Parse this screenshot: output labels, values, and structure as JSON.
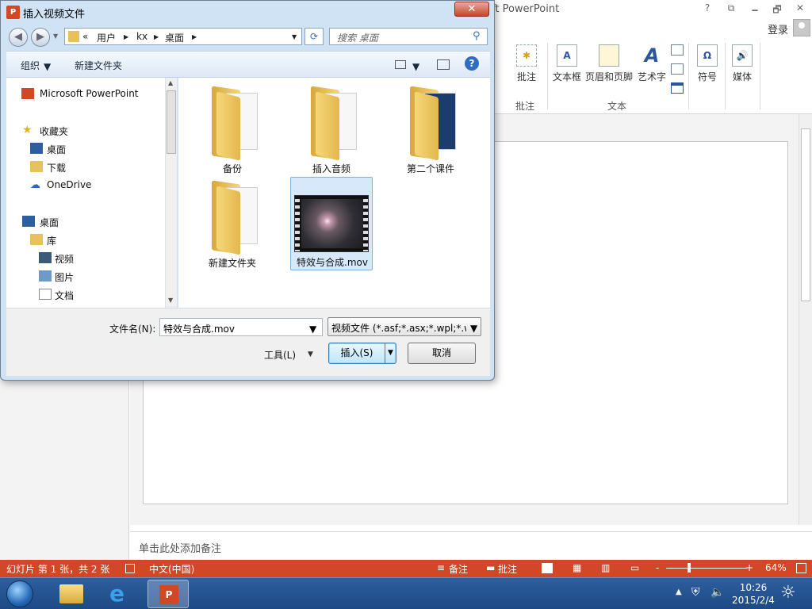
{
  "powerpoint": {
    "title_fragment": "ft PowerPoint",
    "window_controls": {
      "help": "?",
      "restore_ribbon": "⧉",
      "minimize": "🗕",
      "maximize": "🗗",
      "close": "✕"
    },
    "login": "登录",
    "ribbon": {
      "buttons": [
        {
          "label": "批注",
          "icon": "comment-icon"
        },
        {
          "label": "文本框",
          "icon": "textbox-icon"
        },
        {
          "label": "页眉和页脚",
          "icon": "header-footer-icon"
        },
        {
          "label": "艺术字",
          "icon": "wordart-icon"
        },
        {
          "label": "符号",
          "icon": "symbol-icon"
        },
        {
          "label": "媒体",
          "icon": "media-icon"
        }
      ],
      "groups": [
        "批注",
        "文本"
      ],
      "symbol_glyph": "Ω",
      "wordart_glyph": "A"
    },
    "notes_placeholder": "单击此处添加备注",
    "statusbar": {
      "slide_info": "幻灯片 第 1 张，共 2 张",
      "language": "中文(中国)",
      "notes_btn": "备注",
      "comments_btn": "批注",
      "zoom_minus": "-",
      "zoom_plus": "+",
      "zoom": "64%",
      "zoom_fraction": 0.27
    }
  },
  "taskbar": {
    "time": "10:26",
    "date": "2015/2/4"
  },
  "dialog": {
    "title": "插入视频文件",
    "close_label": "✕",
    "address": {
      "prefix": "«",
      "parts": [
        "用户",
        "kx",
        "桌面"
      ]
    },
    "search_placeholder": "搜索 桌面",
    "toolbar": {
      "organize": "组织",
      "new_folder": "新建文件夹"
    },
    "nav": {
      "app": "Microsoft PowerPoint",
      "favorites": "收藏夹",
      "fav_items": [
        "桌面",
        "下载",
        "OneDrive"
      ],
      "desktop": "桌面",
      "library": "库",
      "lib_items": [
        "视频",
        "图片",
        "文档"
      ]
    },
    "files": [
      {
        "name": "备份",
        "type": "folder"
      },
      {
        "name": "插入音频",
        "type": "folder"
      },
      {
        "name": "第二个课件",
        "type": "folder"
      },
      {
        "name": "新建文件夹",
        "type": "folder"
      },
      {
        "name": "特效与合成.mov",
        "type": "video",
        "selected": true
      }
    ],
    "filename_label": "文件名(N):",
    "filename_value": "特效与合成.mov",
    "filetype_value": "视频文件 (*.asf;*.asx;*.wpl;*.wm",
    "tools_label": "工具(L)",
    "insert_label": "插入(S)",
    "cancel_label": "取消"
  },
  "colors": {
    "accent": "#d24726",
    "selection": "#d6e8fa"
  }
}
